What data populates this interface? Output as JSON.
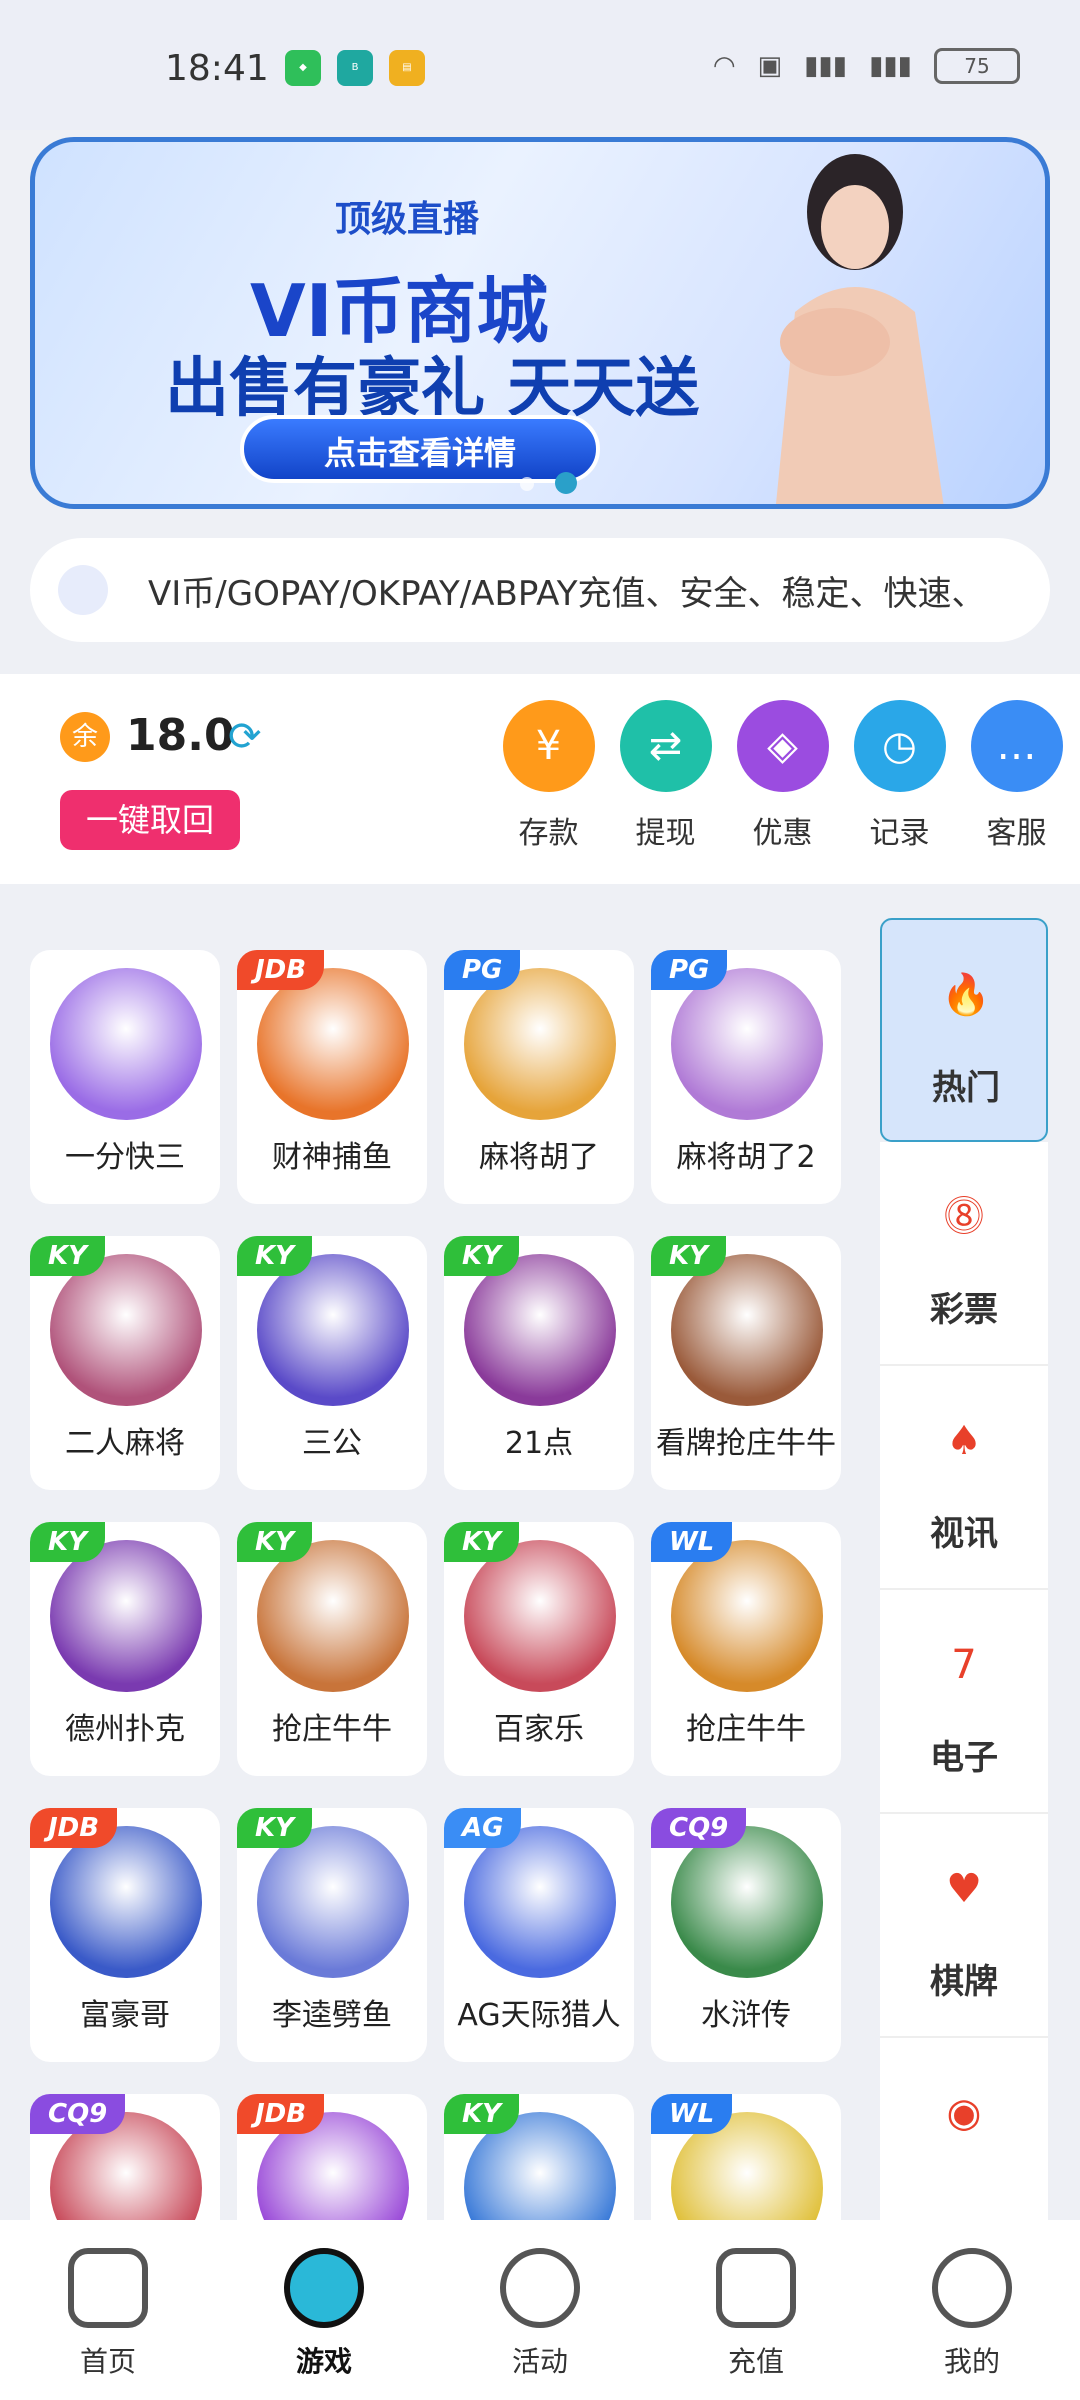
{
  "status_bar": {
    "time": "18:41",
    "apps": [
      "shield-app",
      "boss-app",
      "book-app"
    ],
    "battery": "75"
  },
  "banner": {
    "top_label": "顶级直播",
    "title": "VI币商城",
    "subtitle": "出售有豪礼 天天送",
    "button": "点击查看详情"
  },
  "notice": {
    "text": "VI币/GOPAY/OKPAY/ABPAY充值、安全、稳定、快速、"
  },
  "wallet": {
    "balance_icon": "余",
    "balance": "18.0",
    "withdraw_button": "一键取回",
    "actions": [
      {
        "label": "存款",
        "icon": "yen-icon",
        "color": "#ff9a1a",
        "glyph": "¥"
      },
      {
        "label": "提现",
        "icon": "transfer-icon",
        "color": "#1fc0a8",
        "glyph": "⇄"
      },
      {
        "label": "优惠",
        "icon": "tag-icon",
        "color": "#9b4ce0",
        "glyph": "◈"
      },
      {
        "label": "记录",
        "icon": "clock-icon",
        "color": "#2aa7e8",
        "glyph": "◷"
      },
      {
        "label": "客服",
        "icon": "chat-icon",
        "color": "#3a8df5",
        "glyph": "…"
      }
    ]
  },
  "games": [
    {
      "name": "一分快三",
      "badge": "",
      "badge_color": "",
      "thumb": "#9a6ce6"
    },
    {
      "name": "财神捕鱼",
      "badge": "JDB",
      "badge_color": "#f04a2a",
      "thumb": "#e8742a"
    },
    {
      "name": "麻将胡了",
      "badge": "PG",
      "badge_color": "#2a7df0",
      "thumb": "#e6a43a"
    },
    {
      "name": "麻将胡了2",
      "badge": "PG",
      "badge_color": "#2a7df0",
      "thumb": "#b07ad6"
    },
    {
      "name": "二人麻将",
      "badge": "KY",
      "badge_color": "#2fbf3a",
      "thumb": "#b0527a"
    },
    {
      "name": "三公",
      "badge": "KY",
      "badge_color": "#2fbf3a",
      "thumb": "#5a4ac8"
    },
    {
      "name": "21点",
      "badge": "KY",
      "badge_color": "#2fbf3a",
      "thumb": "#8a3a9a"
    },
    {
      "name": "看牌抢庄牛牛",
      "badge": "KY",
      "badge_color": "#2fbf3a",
      "thumb": "#9a5a3a"
    },
    {
      "name": "德州扑克",
      "badge": "KY",
      "badge_color": "#2fbf3a",
      "thumb": "#7a3ab0"
    },
    {
      "name": "抢庄牛牛",
      "badge": "KY",
      "badge_color": "#2fbf3a",
      "thumb": "#c8743a"
    },
    {
      "name": "百家乐",
      "badge": "KY",
      "badge_color": "#2fbf3a",
      "thumb": "#c84a5a"
    },
    {
      "name": "抢庄牛牛",
      "badge": "WL",
      "badge_color": "#2a7df0",
      "thumb": "#d68a2a"
    },
    {
      "name": "富豪哥",
      "badge": "JDB",
      "badge_color": "#f04a2a",
      "thumb": "#3a5ac8"
    },
    {
      "name": "李逵劈鱼",
      "badge": "KY",
      "badge_color": "#2fbf3a",
      "thumb": "#6a7ad8"
    },
    {
      "name": "AG天际猎人",
      "badge": "AG",
      "badge_color": "#3a8df5",
      "thumb": "#4a6ae0"
    },
    {
      "name": "水浒传",
      "badge": "CQ9",
      "badge_color": "#8a4ce0",
      "thumb": "#3a8a4a"
    },
    {
      "name": "",
      "badge": "CQ9",
      "badge_color": "#8a4ce0",
      "thumb": "#c84a5a"
    },
    {
      "name": "",
      "badge": "JDB",
      "badge_color": "#f04a2a",
      "thumb": "#9a4ad8"
    },
    {
      "name": "",
      "badge": "KY",
      "badge_color": "#2fbf3a",
      "thumb": "#3a7ad8"
    },
    {
      "name": "",
      "badge": "WL",
      "badge_color": "#2a7df0",
      "thumb": "#e0c03a"
    }
  ],
  "categories": [
    {
      "label": "热门",
      "icon": "flame-icon",
      "glyph": "🔥",
      "active": true
    },
    {
      "label": "彩票",
      "icon": "lottery-ball-icon",
      "glyph": "⓼",
      "active": false
    },
    {
      "label": "视讯",
      "icon": "poker-chip-icon",
      "glyph": "♠",
      "active": false
    },
    {
      "label": "电子",
      "icon": "slot-seven-icon",
      "glyph": "7",
      "active": false
    },
    {
      "label": "棋牌",
      "icon": "cards-icon",
      "glyph": "♥",
      "active": false
    },
    {
      "label": "",
      "icon": "fish-icon",
      "glyph": "◉",
      "active": false
    }
  ],
  "tabbar": [
    {
      "label": "首页",
      "icon": "home-icon",
      "active": false
    },
    {
      "label": "游戏",
      "icon": "gamepad-icon",
      "active": true
    },
    {
      "label": "活动",
      "icon": "flag-icon",
      "active": false
    },
    {
      "label": "充值",
      "icon": "wallet-icon",
      "active": false
    },
    {
      "label": "我的",
      "icon": "profile-face-icon",
      "active": false
    }
  ]
}
